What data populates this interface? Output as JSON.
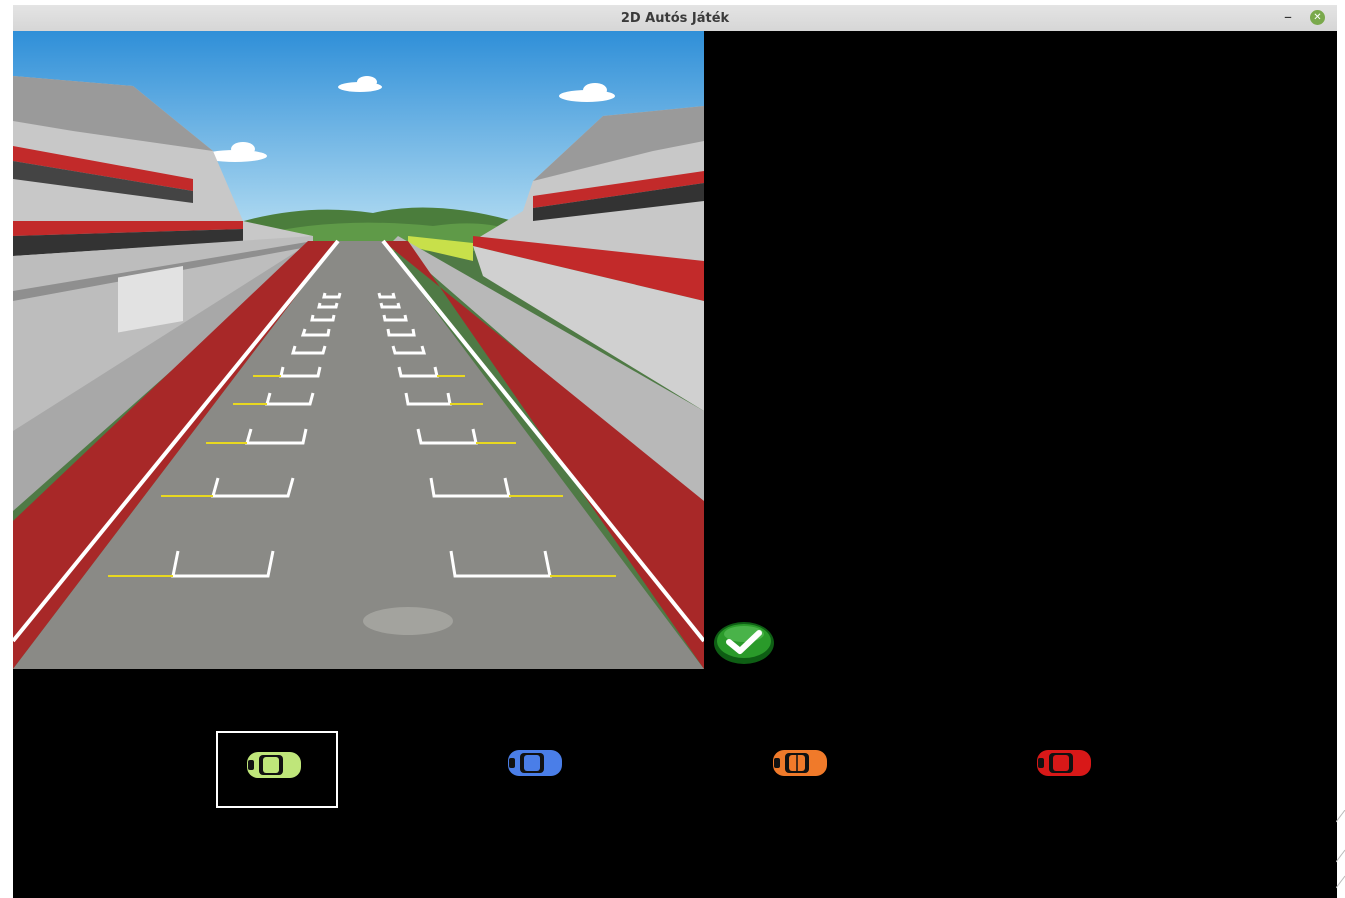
{
  "window": {
    "title": "2D Autós Játék"
  },
  "scene": {
    "name": "race-track-start-grid"
  },
  "confirm": {
    "icon": "checkmark-icon",
    "color": "#1e8a1e"
  },
  "cars": [
    {
      "id": "car-green",
      "color": "#bfe67a",
      "selected": true
    },
    {
      "id": "car-blue",
      "color": "#4a7ee8",
      "selected": false
    },
    {
      "id": "car-orange",
      "color": "#f07a2a",
      "selected": false
    },
    {
      "id": "car-red",
      "color": "#d81818",
      "selected": false
    }
  ]
}
